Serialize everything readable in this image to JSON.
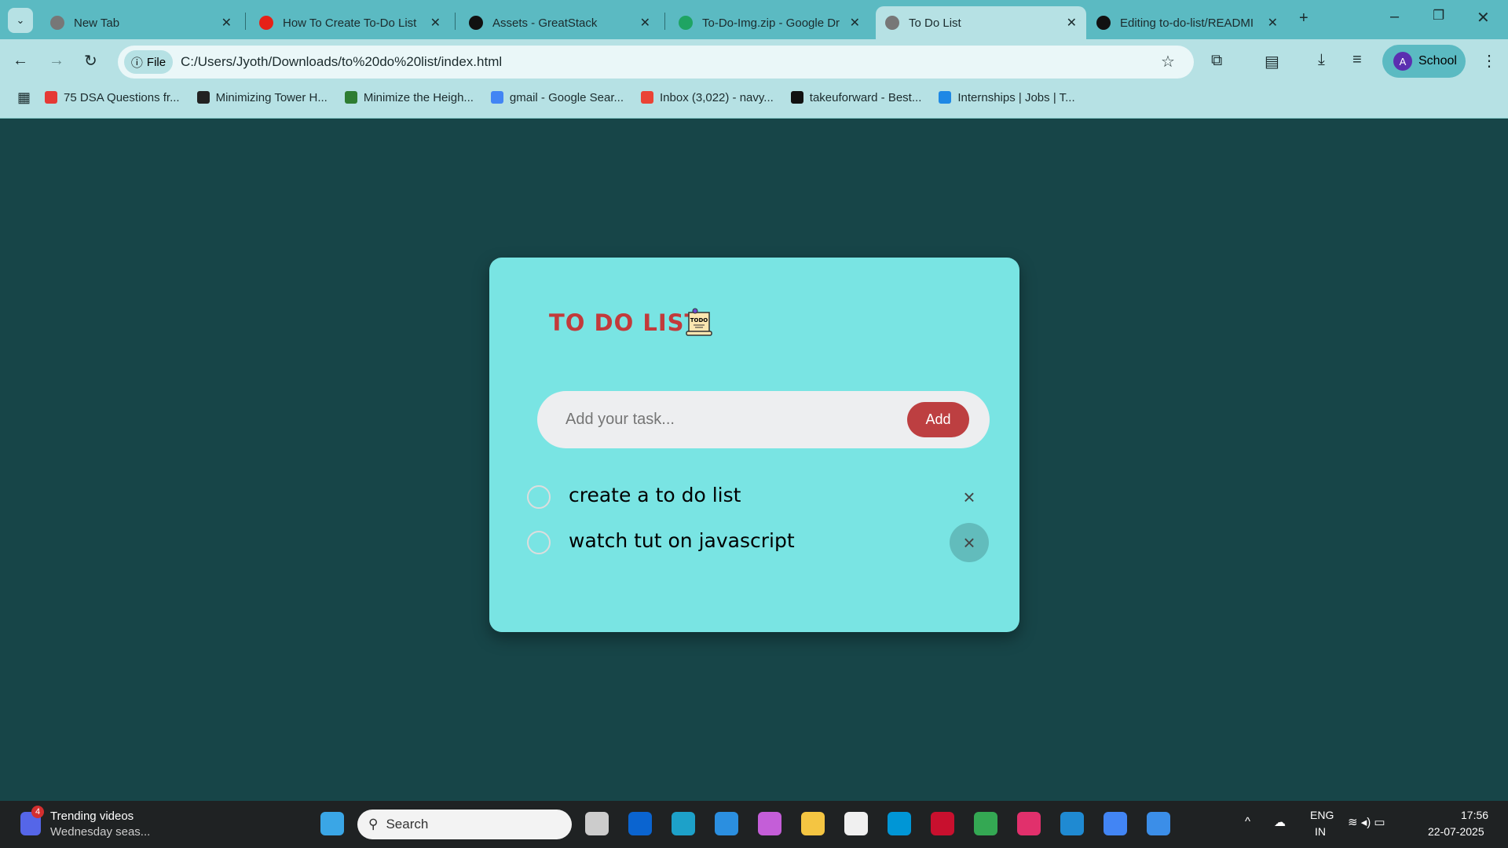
{
  "browser": {
    "tabs": [
      {
        "label": "New Tab",
        "color": "#777"
      },
      {
        "label": "How To Create To-Do List",
        "color": "#e62117"
      },
      {
        "label": "Assets - GreatStack",
        "color": "#111"
      },
      {
        "label": "To-Do-Img.zip - Google Dr",
        "color": "#1fa463"
      },
      {
        "label": "To Do List",
        "color": "#777"
      },
      {
        "label": "Editing to-do-list/READMI",
        "color": "#111"
      }
    ],
    "active_tab": 4,
    "new_tab": "+",
    "url_chip": "File",
    "url": "C:/Users/Jyoth/Downloads/to%20do%20list/index.html",
    "profile_initial": "A",
    "profile_label": "School",
    "bookmarks": [
      {
        "label": "75 DSA Questions fr...",
        "color": "#e53935"
      },
      {
        "label": "Minimizing Tower H...",
        "color": "#222"
      },
      {
        "label": "Minimize the Heigh...",
        "color": "#2e7d32"
      },
      {
        "label": "gmail - Google Sear...",
        "color": "#4285f4"
      },
      {
        "label": "Inbox (3,022) - navy...",
        "color": "#ea4335"
      },
      {
        "label": "takeuforward - Best...",
        "color": "#111"
      },
      {
        "label": "Internships | Jobs | T...",
        "color": "#1e88e5"
      }
    ]
  },
  "app": {
    "title": "TO DO LIST",
    "icon_text": "TODO",
    "input_placeholder": "Add your task...",
    "add_label": "Add",
    "tasks": [
      {
        "text": "create a to do list",
        "done": false
      },
      {
        "text": "watch tut on javascript",
        "done": false
      }
    ],
    "delete_symbol": "×"
  },
  "taskbar": {
    "widget_badge": "4",
    "widget_title": "Trending videos",
    "widget_sub": "Wednesday seas...",
    "search": "Search",
    "lang1": "ENG",
    "lang2": "IN",
    "time": "17:56",
    "date": "22-07-2025"
  }
}
